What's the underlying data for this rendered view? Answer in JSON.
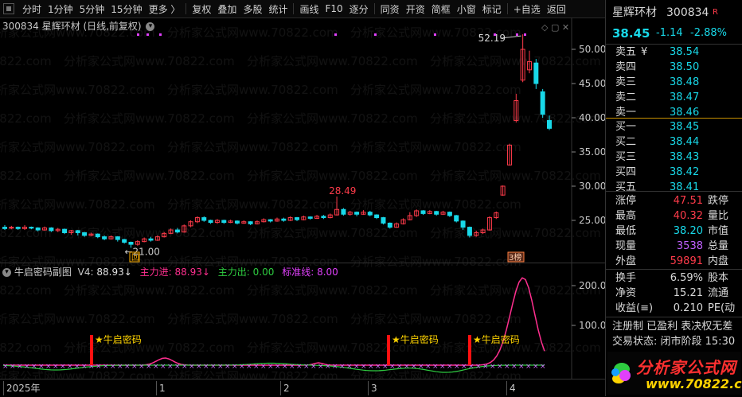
{
  "toolbar": {
    "items": [
      "分时",
      "1分钟",
      "5分钟",
      "15分钟",
      "更多 〉",
      "复权",
      "叠加",
      "多股",
      "统计",
      "画线",
      "F10",
      "逐分",
      "同资",
      "开资",
      "简框",
      "小窗",
      "标记",
      "+自选",
      "返回"
    ]
  },
  "chart_title": "300834 星辉环材 (日线,前复权)",
  "main_chart": {
    "y_ticks": [
      "50.00",
      "45.00",
      "40.00",
      "35.00",
      "30.00",
      "25.00"
    ],
    "high_label": "52.19",
    "mid_label": "28.49",
    "low_label": "21.00",
    "bottom_markers": [
      "回",
      "3榜"
    ]
  },
  "sub_indicator": {
    "name": "牛启密码副图",
    "v4_label": "V4:",
    "v4_value": "88.93",
    "main_in_label": "主力进:",
    "main_in_value": "88.93",
    "main_out_label": "主力出:",
    "main_out_value": "0.00",
    "std_label": "标准线:",
    "std_value": "8.00",
    "y_ticks": [
      "200.0",
      "100.0"
    ],
    "signal_label": "★牛启密码"
  },
  "x_axis": {
    "labels": [
      "2025年",
      "1",
      "2",
      "3",
      "4"
    ]
  },
  "quote": {
    "name": "星辉环材",
    "code": "300834",
    "tag": "R",
    "price": "38.45",
    "change": "-1.14",
    "change_pct": "-2.88%",
    "asks": [
      {
        "label": "卖五",
        "extra": "¥",
        "price": "38.54"
      },
      {
        "label": "卖四",
        "extra": "",
        "price": "38.50"
      },
      {
        "label": "卖三",
        "extra": "",
        "price": "38.48"
      },
      {
        "label": "卖二",
        "extra": "",
        "price": "38.47"
      },
      {
        "label": "卖一",
        "extra": "",
        "price": "38.46"
      }
    ],
    "bids": [
      {
        "label": "买一",
        "price": "38.45"
      },
      {
        "label": "买二",
        "price": "38.44"
      },
      {
        "label": "买三",
        "price": "38.43"
      },
      {
        "label": "买四",
        "price": "38.42"
      },
      {
        "label": "买五",
        "price": "38.41"
      }
    ],
    "stats": [
      {
        "l1": "涨停",
        "v1": "47.51",
        "l2": "跌停"
      },
      {
        "l1": "最高",
        "v1": "40.32",
        "l2": "量比"
      },
      {
        "l1": "最低",
        "v1": "38.20",
        "l2": "市值"
      },
      {
        "l1": "现量",
        "v1": "3538",
        "l2": "总量"
      },
      {
        "l1": "外盘",
        "v1": "59891",
        "l2": "内盘"
      }
    ],
    "stats2": [
      {
        "l1": "换手",
        "v1": "6.59%",
        "l2": "股本"
      },
      {
        "l1": "净资",
        "v1": "15.21",
        "l2": "流通"
      },
      {
        "l1": "收益(≡)",
        "v1": "0.210",
        "l2": "PE(动"
      }
    ],
    "reg_line": "注册制 已盈利 表决权无差",
    "status_line": "交易状态: 闭市阶段 15:30"
  },
  "watermark": "分析家公式网www.70822.com",
  "logo": {
    "line1": "分析家公式网",
    "line2": "www.70822.com"
  },
  "colors": {
    "up": "#ff3b4a",
    "down": "#18d8e8",
    "pink": "#ff2f8f",
    "green": "#2ecc40",
    "yellow": "#ffd400",
    "magenta": "#e040fb"
  }
}
